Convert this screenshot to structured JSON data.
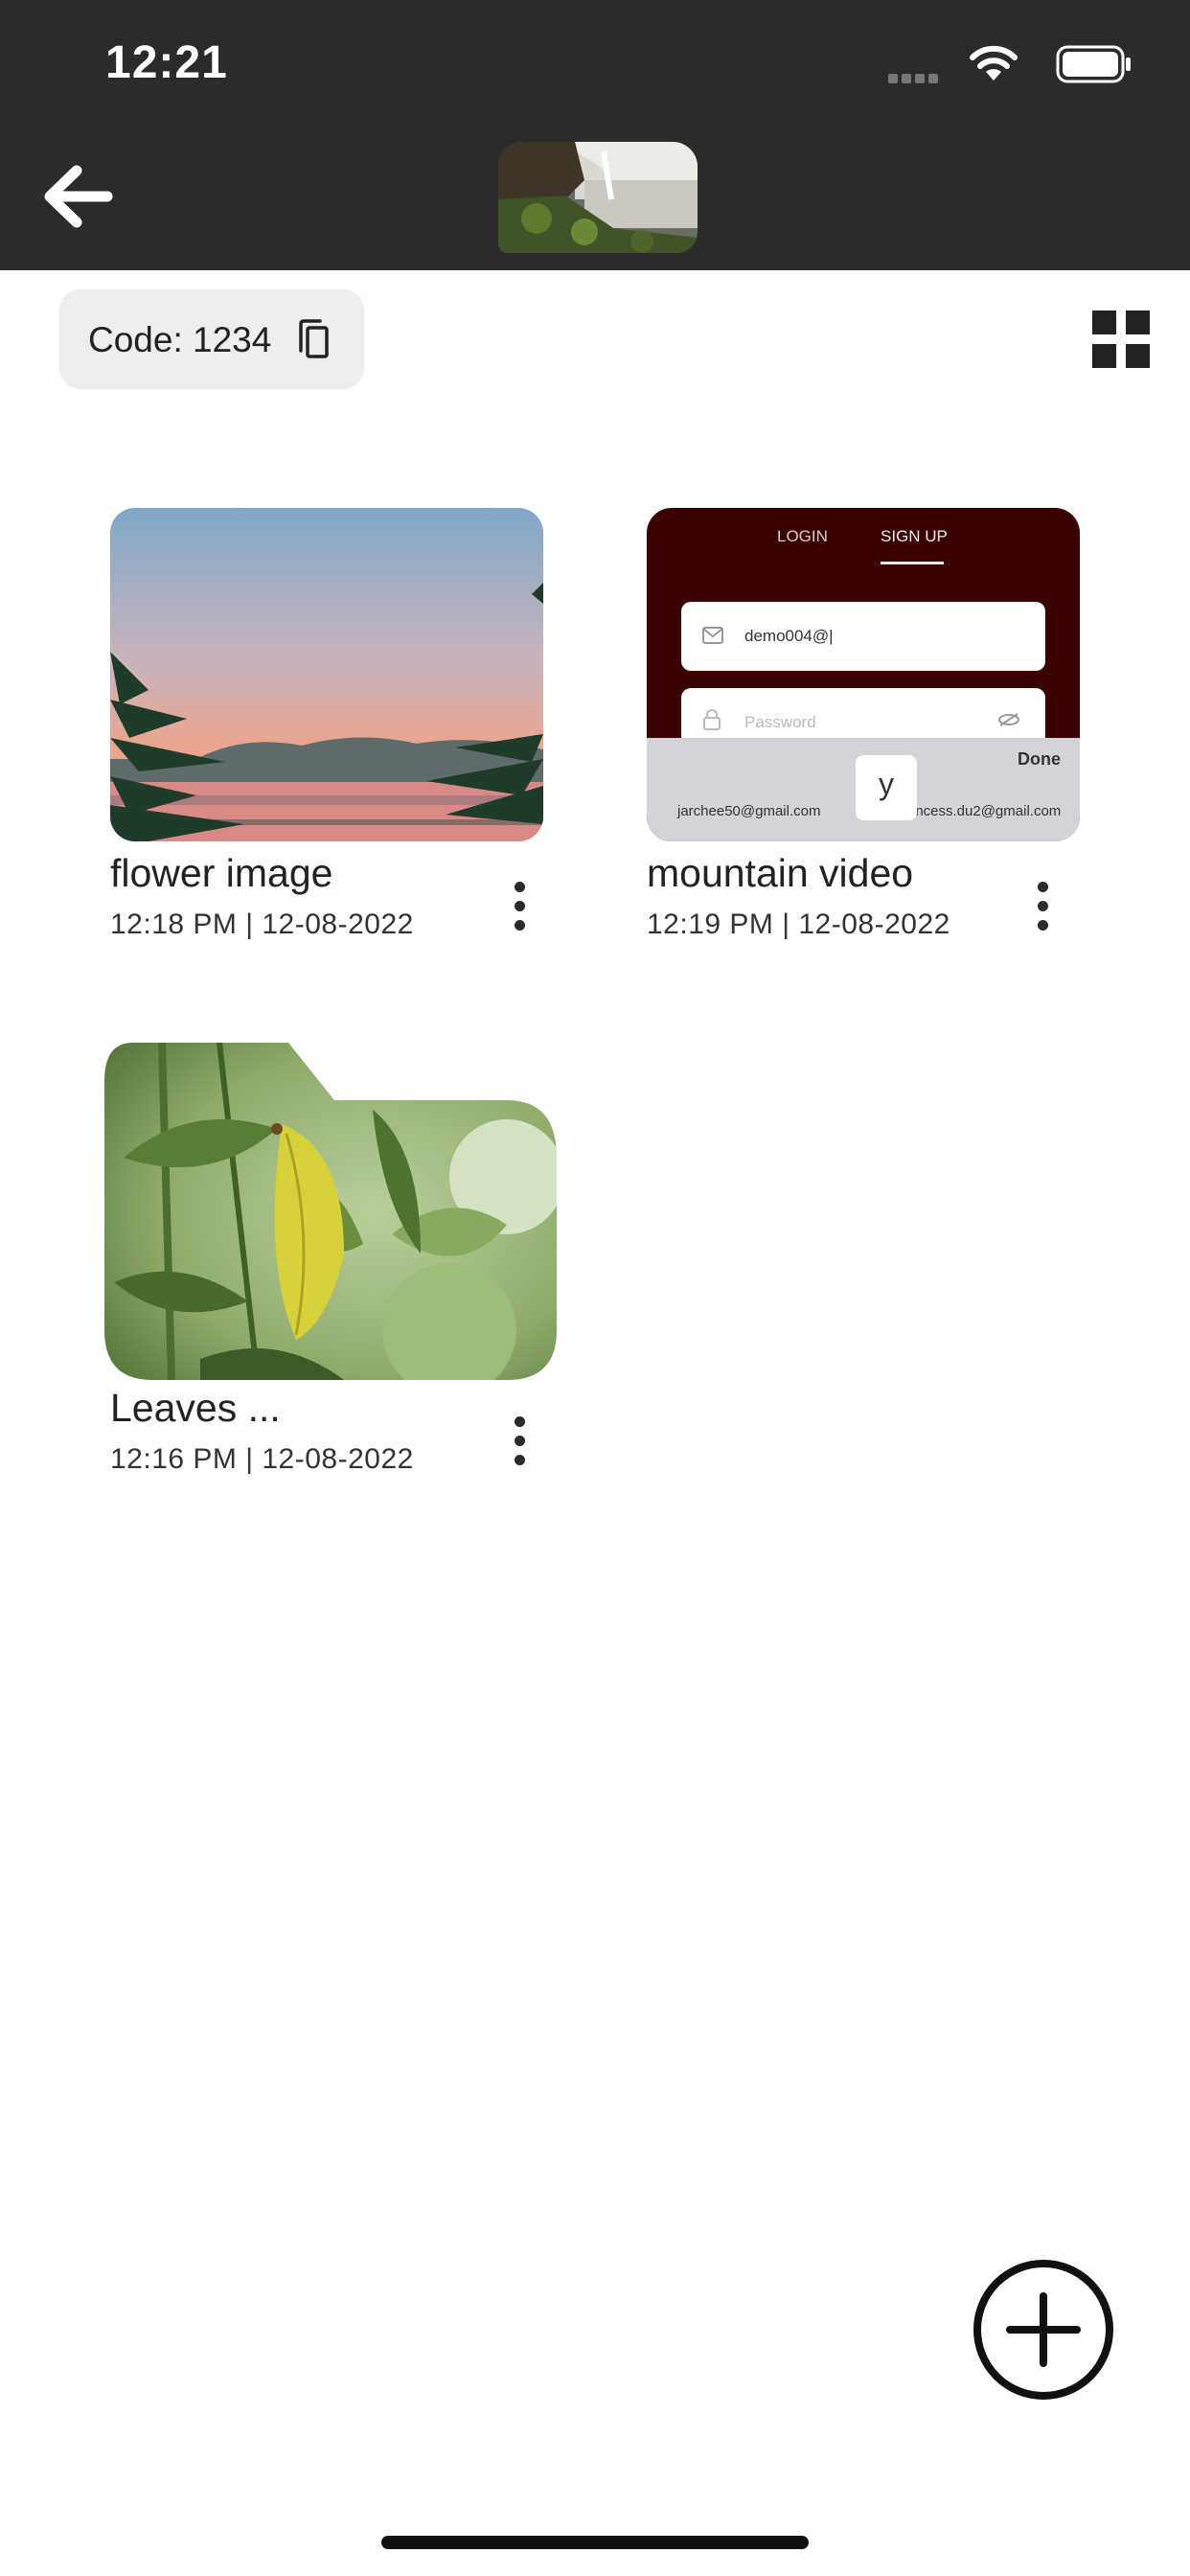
{
  "status_bar": {
    "time": "12:21",
    "icons": [
      "signal-icon",
      "wifi-icon",
      "battery-icon"
    ]
  },
  "nav": {
    "back_icon": "arrow-left-icon",
    "header_image": "waterfall-thumbnail"
  },
  "code_chip": {
    "label": "Code: 1234",
    "icon": "copy-icon"
  },
  "view_toggle": {
    "icon": "grid-view-icon"
  },
  "items": [
    {
      "title": "flower image",
      "meta": "12:18 PM | 12-08-2022",
      "thumbnail": "sunset-palms-photo",
      "menu_icon": "more-vertical-icon"
    },
    {
      "title": "mountain video",
      "meta": "12:19 PM | 12-08-2022",
      "thumbnail": "signup-screen-video",
      "menu_icon": "more-vertical-icon",
      "preview": {
        "tab_login": "LOGIN",
        "tab_signup": "SIGN UP",
        "email_value": "demo004@|",
        "password_placeholder": "Password",
        "done_label": "Done",
        "suggestion_left": "jarchee50@gmail.com",
        "suggestion_right": "rincess.du2@gmail.com",
        "key": "y"
      }
    },
    {
      "title": "Leaves ...",
      "meta": "12:16 PM | 12-08-2022",
      "thumbnail": "green-leaves-photo",
      "menu_icon": "more-vertical-icon"
    }
  ],
  "fab": {
    "icon": "add-circle-icon"
  },
  "colors": {
    "topbar": "#2b2b2b",
    "chip_bg": "#eeeeef",
    "text": "#222222",
    "preview_bg": "#3a0000"
  }
}
